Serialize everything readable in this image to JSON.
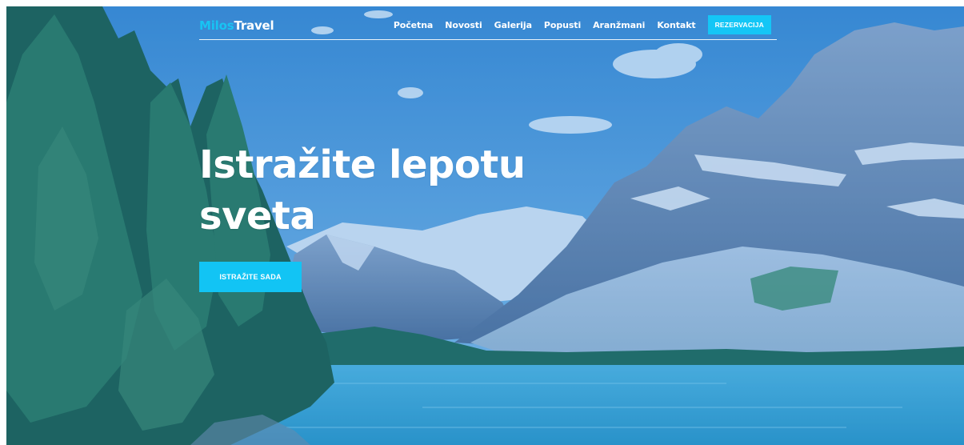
{
  "logo": {
    "part1": "Milos",
    "part2": "Travel"
  },
  "nav": {
    "items": [
      {
        "label": "Početna"
      },
      {
        "label": "Novosti"
      },
      {
        "label": "Galerija"
      },
      {
        "label": "Popusti"
      },
      {
        "label": "Aranžmani"
      },
      {
        "label": "Kontakt"
      }
    ],
    "reserve_label": "REZERVACIJA"
  },
  "hero": {
    "title_line1": "Istražite lepotu",
    "title_line2": "sveta",
    "cta_label": "ISTRAŽITE SADA",
    "background_image": "mountain-lake-forest"
  },
  "colors": {
    "accent": "#14c6f6",
    "text": "#ffffff"
  }
}
